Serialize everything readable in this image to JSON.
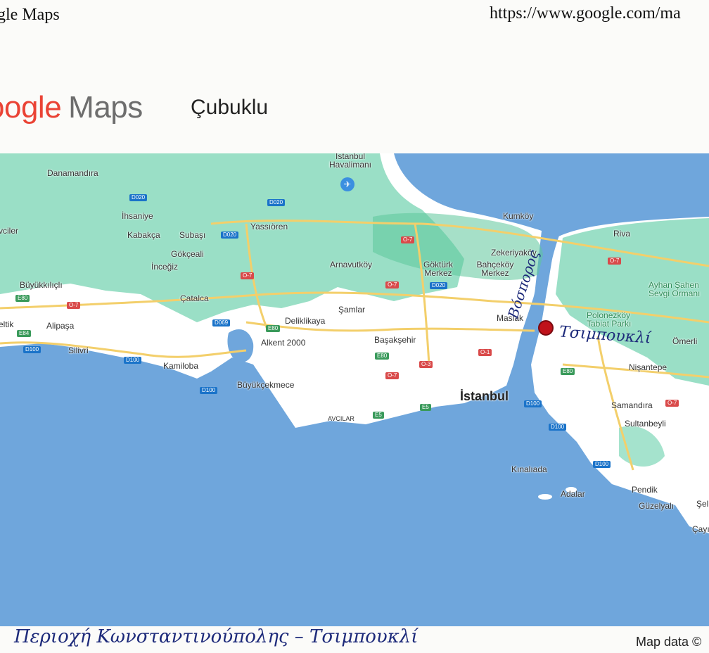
{
  "header": {
    "print_title": "gle Maps",
    "url": "https://www.google.com/ma"
  },
  "brand": {
    "google": "oogle",
    "maps": "Maps"
  },
  "search": {
    "place": "Çubuklu"
  },
  "map": {
    "colors": {
      "sea": "#6fa6dc",
      "land": "#ffffff",
      "forest": "#8fdcc0",
      "road": "#f3cf6b"
    },
    "places": {
      "danamandira": "Danamandıra",
      "ihsaniye": "İhsaniye",
      "kabakca": "Kabakça",
      "subasi": "Subaşı",
      "yassioren": "Yassıören",
      "gokceali": "Gökçeali",
      "incegiz": "İnceğiz",
      "buyukkilicli": "Büyükkılıçlı",
      "catalca": "Çatalca",
      "eltik": "eltik",
      "alipasa": "Alipaşa",
      "silivri": "Silivri",
      "kamiloba": "Kamiloba",
      "deliklikaya": "Deliklikaya",
      "alkent": "Alkent 2000",
      "buyukcekmece": "Büyükçekmece",
      "avcilar": "AVCILAR",
      "samlar": "Şamlar",
      "arnavutkoy": "Arnavutköy",
      "basaksehir": "Başakşehir",
      "istanbul": "İstanbul",
      "airport": "İstanbul Havalimanı",
      "kumkoy": "Kumköy",
      "goktruk": "Göktürk Merkez",
      "bahcekoy": "Bahçeköy Merkez",
      "zekeriyakoy": "Zekeriyaköy",
      "maslak": "Maslak",
      "riva": "Riva",
      "polonezkoy": "Polonezköy Tabiat Parkı",
      "ayhan": "Ayhan Şahen Sevgi Ormanı",
      "omerli": "Ömerli",
      "nisantepe": "Nişantepe",
      "samandira": "Samandıra",
      "sultanbeyli": "Sultanbeyli",
      "kinaliada": "Kınalıada",
      "adalar": "Adalar",
      "pendik": "Pendik",
      "guzelyali": "Güzelyalı",
      "cay": "Çayı",
      "sel": "Şel",
      "viler": "vciler"
    },
    "roads": {
      "d020a": "D020",
      "d020b": "D020",
      "d020c": "D020",
      "d020d": "D020",
      "o7a": "O-7",
      "o7b": "O-7",
      "o7c": "O-7",
      "o7d": "O-7",
      "o7e": "O-7",
      "o7f": "O-7",
      "o7g": "O-7",
      "e80a": "E80",
      "e80b": "E80",
      "e80c": "E80",
      "e80d": "E80",
      "e84": "E84",
      "d100a": "D100",
      "d100b": "D100",
      "d100c": "D100",
      "d100d": "D100",
      "d100e": "D100",
      "d100f": "D100",
      "o1": "O-1",
      "o3": "O-3",
      "e5a": "E5",
      "e5b": "E5",
      "d069": "D069"
    }
  },
  "annotations": {
    "bosporus": "Βόσπορος",
    "tsimpoukli": "Τσιμπουκλί",
    "caption": "Περιοχή Κωνσταντινούπολης – Τσιμπουκλί"
  },
  "footer": {
    "map_data": "Map data ©"
  }
}
